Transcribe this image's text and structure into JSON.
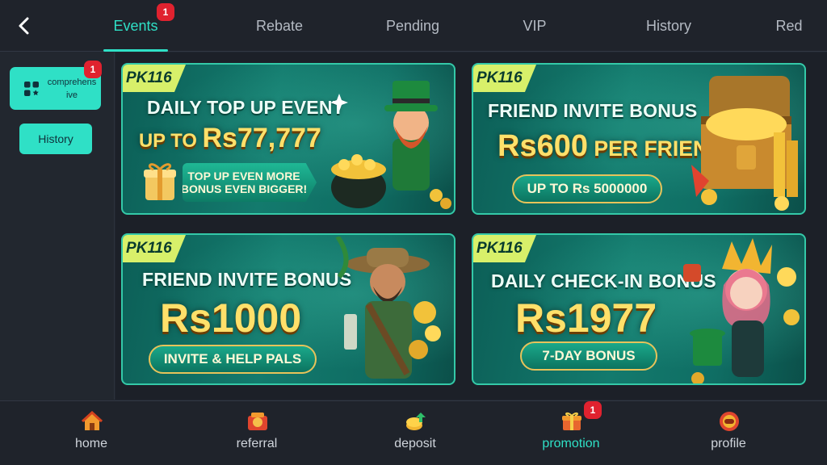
{
  "tabs": [
    {
      "label": "Events",
      "active": true,
      "badge": "1"
    },
    {
      "label": "Rebate"
    },
    {
      "label": "Pending"
    },
    {
      "label": "VIP"
    },
    {
      "label": "History"
    },
    {
      "label": "Red"
    }
  ],
  "sidebar": {
    "category_label": "comprehensive",
    "category_badge": "1",
    "history_label": "History"
  },
  "cards": [
    {
      "tag": "PK116",
      "title": "DAILY TOP UP EVENT",
      "amount_prefix": "UP TO ",
      "amount": "Rs77,777",
      "button": "TOP UP EVEN MORE BONUS EVEN BIGGER!",
      "button_line1": "TOP UP EVEN MORE",
      "button_line2": "BONUS EVEN BIGGER!",
      "art": "leprechaun-with-gold-pot"
    },
    {
      "tag": "PK116",
      "title": "FRIEND INVITE BONUS",
      "amount": "Rs600",
      "amount_suffix": " PER FRIEND",
      "button": "UP TO Rs 5000000",
      "art": "treasure-chest"
    },
    {
      "tag": "PK116",
      "title": "FRIEND INVITE BONUS",
      "amount": "Rs1000",
      "button": "INVITE & HELP PALS",
      "art": "explorer-with-coins"
    },
    {
      "tag": "PK116",
      "title": "DAILY CHECK-IN BONUS",
      "amount": "Rs1977",
      "button": "7-DAY BONUS",
      "art": "jester-girl-with-coins"
    }
  ],
  "bottom_nav": [
    {
      "label": "home",
      "icon": "home-icon"
    },
    {
      "label": "referral",
      "icon": "referral-icon"
    },
    {
      "label": "deposit",
      "icon": "deposit-icon"
    },
    {
      "label": "promotion",
      "icon": "promotion-icon",
      "active": true,
      "badge": "1"
    },
    {
      "label": "profile",
      "icon": "profile-icon"
    }
  ],
  "colors": {
    "accent": "#2fe0c6",
    "badge": "#e0222f",
    "background": "#212630",
    "card_green": "#137a6d",
    "gold": "#ffe06a"
  }
}
